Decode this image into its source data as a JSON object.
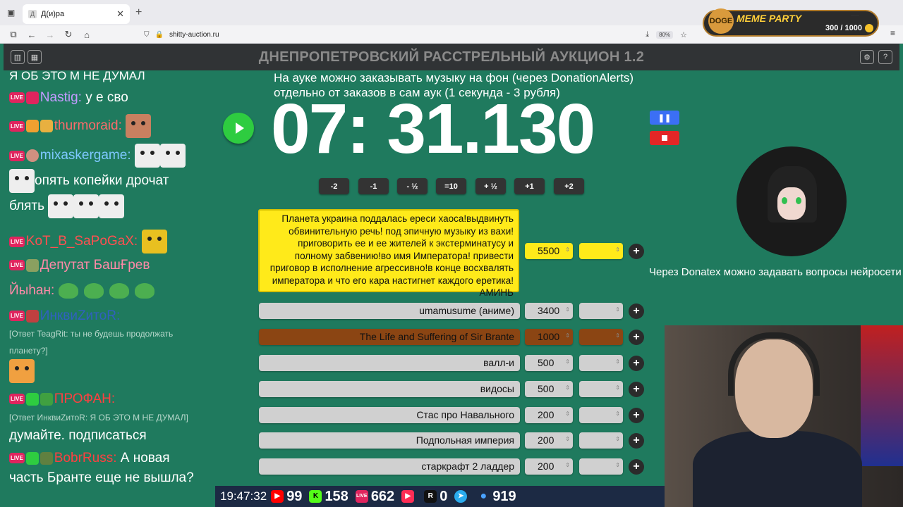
{
  "browser": {
    "tab_title": "Д(и)ра",
    "tab_favicon": "Д",
    "url": "shitty-auction.ru",
    "zoom": "80%"
  },
  "meme_party": {
    "logo": "DOGE",
    "title": "MEME PARTY",
    "score": "300 / 1000"
  },
  "app": {
    "title": "ДНЕПРОПЕТРОВСКИЙ РАССТРЕЛЬНЫЙ АУКЦИОН 1.2"
  },
  "chat": {
    "top_text": "Я ОБ ЭТО М НЕ ДУМАЛ",
    "m1_nick": "Nastig:",
    "m1_text": " у е сво",
    "m2_nick": "thurmoraid:",
    "m3_nick": "mixaskergame:",
    "m3_text1": "опять копейки дрочат",
    "m3_text2": "блять",
    "m4_nick": "KoT_B_SaPoGaX:",
    "m5_nick": "Депутат БашҒрев",
    "m5_text": "Йыһан:",
    "m6_nick": "ИнквиZитоR:",
    "m6_reply": "[Ответ TeagRit: ты не будешь продолжать планету?]",
    "m7_nick": "ПРОФАН:",
    "m7_reply": "[Ответ ИнквиZитоR: Я ОБ ЭТО М НЕ ДУМАЛ]",
    "m7_text": "думайте. подписаться",
    "m8_nick": "BobrRuss:",
    "m8_text1": " А новая",
    "m8_text2": "часть Бранте еще не вышла?",
    "live_label": "LIVE"
  },
  "notice": {
    "line1": "На ауке можно заказывать музыку на фон (через DonationAlerts)",
    "line2": "отдельно от заказов в сам аук (1 секунда - 3 рубля)"
  },
  "timer": {
    "value": "07: 31.130"
  },
  "adjust_buttons": [
    "-2",
    "-1",
    "- ½",
    "=10",
    "+ ½",
    "+1",
    "+2"
  ],
  "lots": [
    {
      "name": "Планета украина поддалась ереси хаоса!выдвинуть обвинительную речь! под эпичную музыку из вахи! приговорить ее и ее жителей к экстерминатусу и полному забвению!во имя Императора! привести приговор в исполнение агрессивно!в конце восхвалять императора и что его кара настигнет каждого еретика! АМИНЬ",
      "amount": "5500",
      "color": "#ffea1a"
    },
    {
      "name": "umamusume (аниме)",
      "amount": "3400",
      "color": "#d0d0d0"
    },
    {
      "name": "The Life and Suffering of Sir Brante",
      "amount": "1000",
      "color": "#8b4513"
    },
    {
      "name": "валл-и",
      "amount": "500",
      "color": "#d0d0d0"
    },
    {
      "name": "видосы",
      "amount": "500",
      "color": "#d0d0d0"
    },
    {
      "name": "Стас про Навального",
      "amount": "200",
      "color": "#d0d0d0"
    },
    {
      "name": "Подпольная империя",
      "amount": "200",
      "color": "#d0d0d0"
    },
    {
      "name": "старкрафт 2 ладдер",
      "amount": "200",
      "color": "#d0d0d0"
    }
  ],
  "donatex_text": "Через Donatex можно задавать вопросы нейросети",
  "stats": {
    "time": "19:47:32",
    "youtube": "99",
    "kick": "158",
    "vkplay": "662",
    "play_icon": "▶",
    "rutube": "0",
    "telegram": "",
    "viewers": "919",
    "icons": [
      "youtube-icon",
      "kick-icon",
      "vkplay-icon",
      "play-icon",
      "rutube-icon",
      "telegram-icon",
      "viewers-icon"
    ]
  }
}
